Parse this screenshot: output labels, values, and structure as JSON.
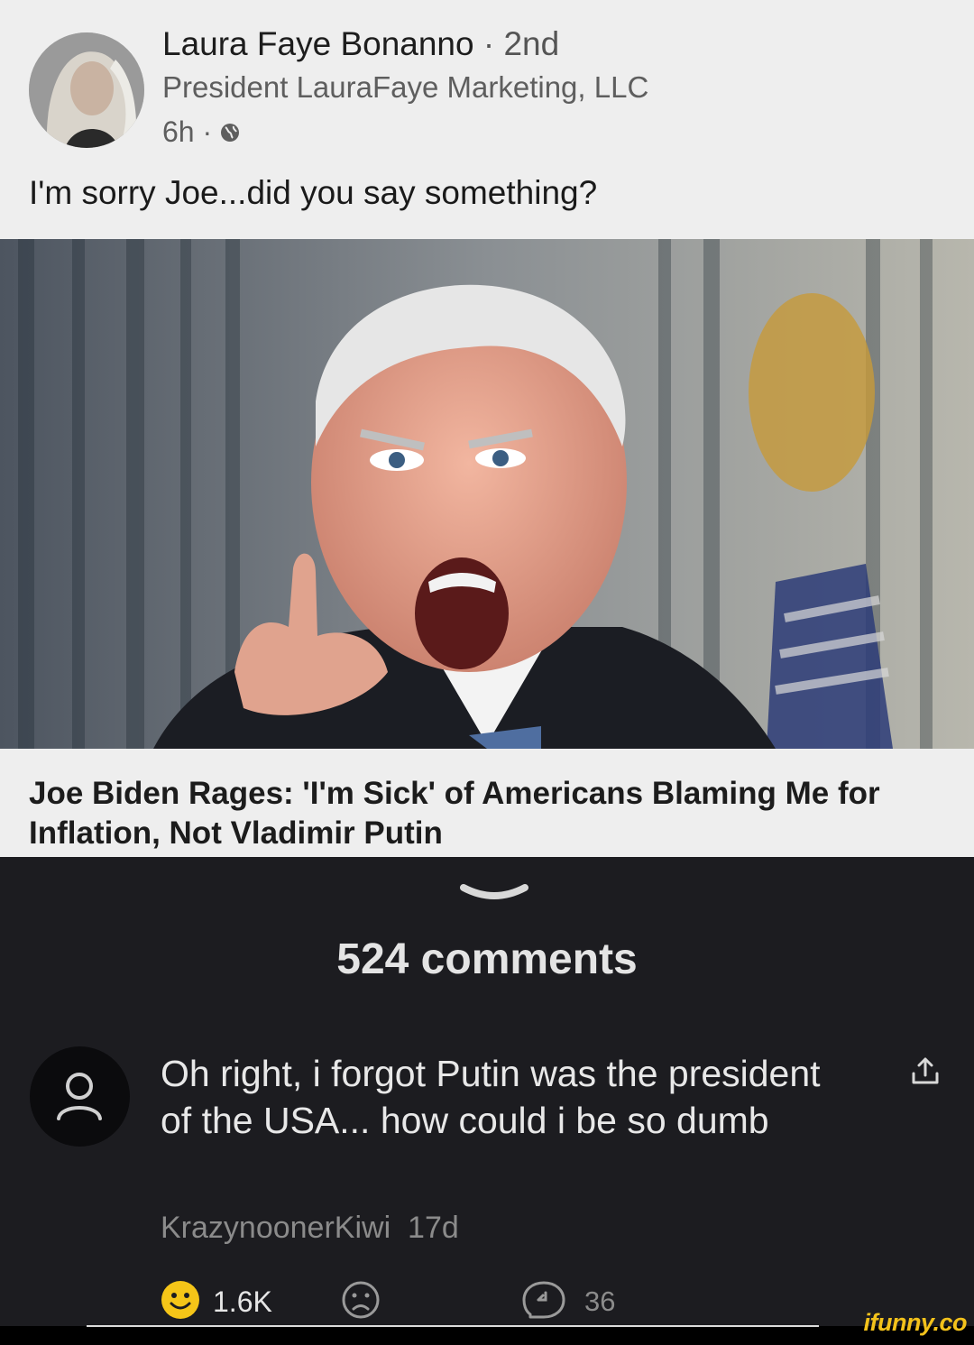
{
  "post": {
    "author_name": "Laura Faye Bonanno",
    "degree": "· 2nd",
    "author_title": "President LauraFaye Marketing, LLC",
    "time": "6h ·",
    "text": "I'm sorry Joe...did you say something?",
    "headline": "Joe Biden Rages: 'I'm Sick' of Americans Blaming Me for Inflation, Not Vladimir Putin",
    "visibility_icon": "globe-icon"
  },
  "comments": {
    "count_label": "524 comments",
    "items": [
      {
        "text": "Oh right, i forgot Putin was the president of the USA... how could i be so dumb",
        "author": "KrazynoonerKiwi",
        "age": "17d",
        "likes": "1.6K",
        "replies": "36"
      }
    ]
  },
  "watermark": "ifunny.co",
  "colors": {
    "post_bg": "#eeeeee",
    "comments_bg": "#1c1c20",
    "smile_yellow": "#f5c518",
    "watermark_yellow": "#f3c21b"
  }
}
